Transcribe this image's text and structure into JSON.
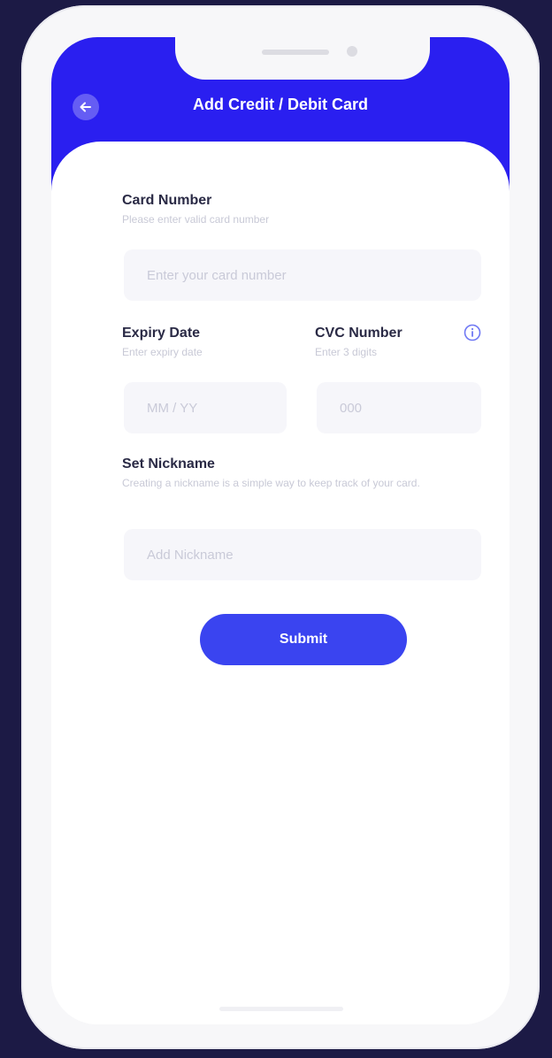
{
  "header": {
    "title": "Add Credit / Debit Card",
    "back_icon": "arrow-left-icon",
    "background_color": "#2a1ff0"
  },
  "card_number": {
    "label": "Card Number",
    "hint": "Please enter valid card number",
    "placeholder": "Enter your card number"
  },
  "expiry": {
    "label": "Expiry Date",
    "hint": "Enter expiry date",
    "placeholder": "MM / YY"
  },
  "cvc": {
    "label": "CVC Number",
    "hint": "Enter 3 digits",
    "placeholder": "000",
    "info_icon": "info-icon"
  },
  "nickname": {
    "label": "Set Nickname",
    "hint": "Creating a nickname is a simple way to keep track of your card.",
    "placeholder": "Add Nickname"
  },
  "submit": {
    "label": "Submit",
    "color": "#3a44f0"
  }
}
